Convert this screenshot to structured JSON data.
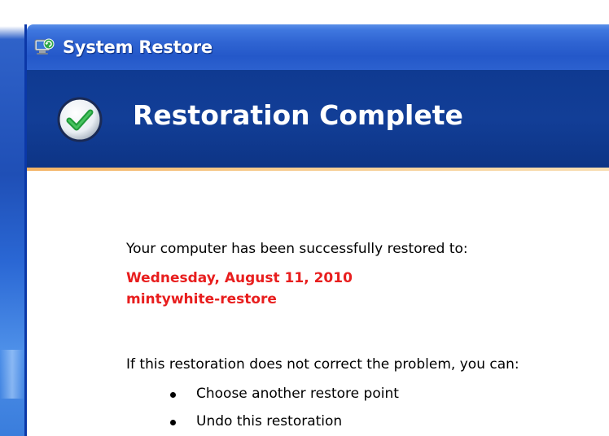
{
  "window": {
    "title": "System Restore",
    "title_icon": "system-restore-icon"
  },
  "header": {
    "title": "Restoration Complete",
    "icon": "green-checkmark-icon",
    "colors": {
      "title_bar": "#2f64d2",
      "header_band": "#123e97",
      "accent_line": "#f2a64a"
    }
  },
  "body": {
    "intro": "Your computer has been successfully restored to:",
    "restore_date": "Wednesday, August 11, 2010",
    "restore_point_name": "mintywhite-restore",
    "restore_text_color": "#e81e1e",
    "help_text": "If this restoration does not correct the problem, you can:",
    "options": [
      {
        "label": "Choose another restore point"
      },
      {
        "label": "Undo this restoration"
      }
    ]
  }
}
